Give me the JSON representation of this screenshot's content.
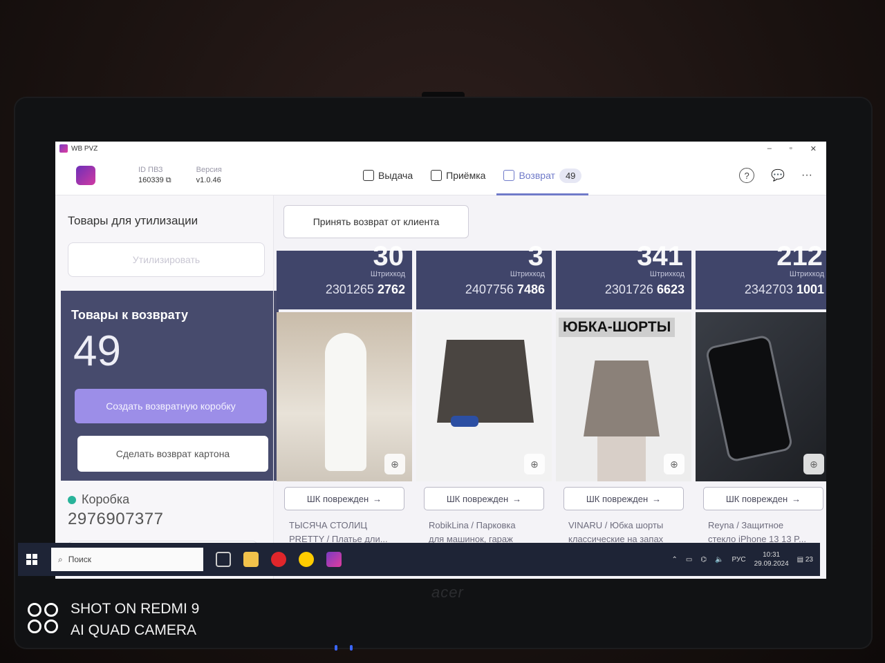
{
  "window": {
    "title": "WB PVZ",
    "controls": [
      "–",
      "▫",
      "✕"
    ]
  },
  "header": {
    "id_label": "ID ПВЗ",
    "id_value": "160339",
    "version_label": "Версия",
    "version_value": "v1.0.46",
    "nav": [
      {
        "label": "Выдача",
        "icon": "box-out-icon"
      },
      {
        "label": "Приёмка",
        "icon": "boxes-icon"
      },
      {
        "label": "Возврат",
        "icon": "return-box-icon",
        "badge": "49",
        "active": true
      }
    ],
    "right_icons": [
      "help-icon",
      "chat-icon",
      "more-icon"
    ]
  },
  "sidebar": {
    "utilization_title": "Товары для утилизации",
    "utilize_button": "Утилизировать",
    "returns_title": "Товары к возврату",
    "returns_count": "49",
    "create_box_button": "Создать возвратную коробку",
    "carton_return_button": "Сделать возврат картона",
    "box_label": "Коробка",
    "box_number": "2976907377"
  },
  "main": {
    "accept_return_button": "Принять возврат от клиента",
    "barcode_label": "Штрихкод",
    "damaged_button": "ШК поврежден",
    "cards": [
      {
        "top_number": "30",
        "barcode_prefix": "2301265",
        "barcode_suffix": "2762",
        "image_bg": "#d9cfc3",
        "title_line1": "ТЫСЯЧА СТОЛИЦ",
        "title_line2": "PRETTY / Платье дли..."
      },
      {
        "top_number": "3",
        "barcode_prefix": "2407756",
        "barcode_suffix": "7486",
        "image_bg": "#f1f1f1",
        "title_line1": "RobikLina / Парковка",
        "title_line2": "для машинок, гараж"
      },
      {
        "top_number": "341",
        "barcode_prefix": "2301726",
        "barcode_suffix": "6623",
        "image_bg": "#ececec",
        "overlay": "ЮБКА-ШОРТЫ",
        "title_line1": "VINARU / Юбка шорты",
        "title_line2": "классические на запах"
      },
      {
        "top_number": "212",
        "barcode_prefix": "2342703",
        "barcode_suffix": "1001",
        "image_bg": "#2a2d33",
        "title_line1": "Reyna / Защитное",
        "title_line2": "стекло iPhone 13 13 P..."
      }
    ]
  },
  "taskbar": {
    "search_placeholder": "Поиск",
    "lang": "РУС",
    "time": "10:31",
    "date": "29.09.2024",
    "notifications": "23"
  },
  "photo": {
    "brand": "acer",
    "watermark_line1": "SHOT ON REDMI 9",
    "watermark_line2": "AI QUAD CAMERA"
  }
}
